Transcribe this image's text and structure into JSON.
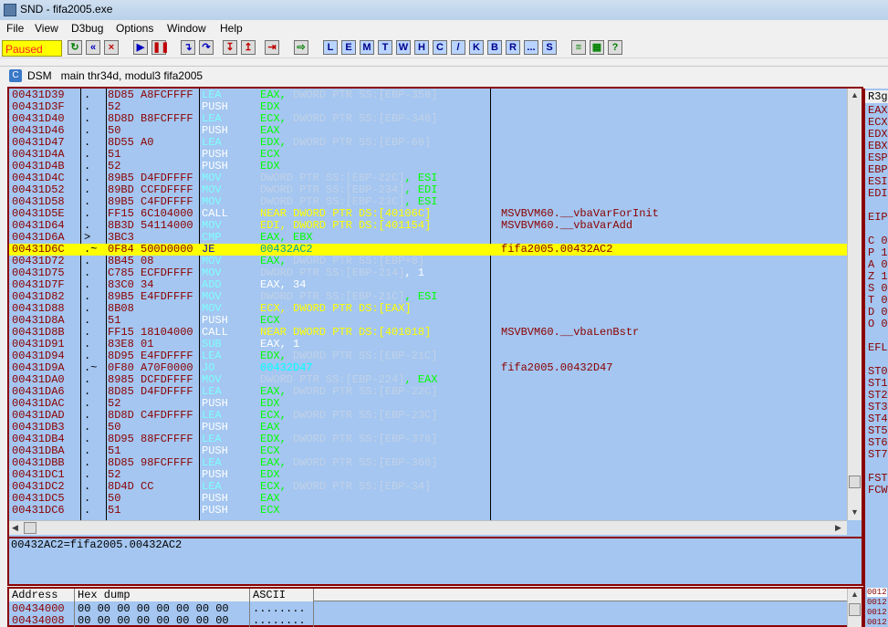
{
  "window": {
    "title": "SND - fifa2005.exe"
  },
  "menu": [
    "File",
    "View",
    "D3bug",
    "Options",
    "Window",
    "Help"
  ],
  "status": "Paused",
  "toolbar_letters": [
    "L",
    "E",
    "M",
    "T",
    "W",
    "H",
    "C",
    "/",
    "K",
    "B",
    "R",
    "...",
    "S"
  ],
  "dsm": {
    "title": "DSM   main thr34d, modul3 fifa2005"
  },
  "code": [
    {
      "addr": "00431D39",
      "mark": ".",
      "hex": "8D85 A8FCFFFF",
      "mn": "LEA",
      "op": "EAX,",
      "opc": "#00ff00",
      "blur": "DWORD PTR SS:[EBP-358]",
      "cm": ""
    },
    {
      "addr": "00431D3F",
      "mark": ".",
      "hex": "52",
      "mn": "PUSH",
      "op": "EDX",
      "opc": "#00ff00",
      "blur": "",
      "cm": ""
    },
    {
      "addr": "00431D40",
      "mark": ".",
      "hex": "8D8D B8FCFFFF",
      "mn": "LEA",
      "op": "ECX,",
      "opc": "#00ff00",
      "blur": "DWORD PTR SS:[EBP-348]",
      "cm": ""
    },
    {
      "addr": "00431D46",
      "mark": ".",
      "hex": "50",
      "mn": "PUSH",
      "op": "EAX",
      "opc": "#00ff00",
      "blur": "",
      "cm": ""
    },
    {
      "addr": "00431D47",
      "mark": ".",
      "hex": "8D55 A0",
      "mn": "LEA",
      "op": "EDX,",
      "opc": "#00ff00",
      "blur": "DWORD PTR SS:[EBP-60]",
      "cm": ""
    },
    {
      "addr": "00431D4A",
      "mark": ".",
      "hex": "51",
      "mn": "PUSH",
      "op": "ECX",
      "opc": "#00ff00",
      "blur": "",
      "cm": ""
    },
    {
      "addr": "00431D4B",
      "mark": ".",
      "hex": "52",
      "mn": "PUSH",
      "op": "EDX",
      "opc": "#00ff00",
      "blur": "",
      "cm": ""
    },
    {
      "addr": "00431D4C",
      "mark": ".",
      "hex": "89B5 D4FDFFFF",
      "mn": "MOV",
      "op": ", ESI",
      "opc": "#00ff00",
      "blur": "DWORD PTR SS:[EBP-22C]",
      "cm": ""
    },
    {
      "addr": "00431D52",
      "mark": ".",
      "hex": "89BD CCFDFFFF",
      "mn": "MOV",
      "op": ", EDI",
      "opc": "#00ff00",
      "blur": "DWORD PTR SS:[EBP-234]",
      "cm": ""
    },
    {
      "addr": "00431D58",
      "mark": ".",
      "hex": "89B5 C4FDFFFF",
      "mn": "MOV",
      "op": ", ESI",
      "opc": "#00ff00",
      "blur": "DWORD PTR SS:[EBP-23C]",
      "cm": ""
    },
    {
      "addr": "00431D5E",
      "mark": ".",
      "hex": "FF15 6C104000",
      "mn": "CALL",
      "op": "NEAR DWORD PTR DS:[40106C]",
      "opc": "#ffff00",
      "blur": "",
      "cm": "MSVBVM60.__vbaVarForInit"
    },
    {
      "addr": "00431D64",
      "mark": ".",
      "hex": "8B3D 54114000",
      "mn": "MOV",
      "op": "EDI, DWORD PTR DS:[401154]",
      "opc": "#ffff00",
      "blur": "",
      "cm": "MSVBVM60.__vbaVarAdd"
    },
    {
      "addr": "00431D6A",
      "mark": ">",
      "hex": "3BC3",
      "mn": "CMP",
      "op": "EAX, EBX",
      "opc": "#00ff00",
      "blur": "",
      "cm": ""
    },
    {
      "addr": "00431D6C",
      "mark": ".~",
      "hex": "0F84 500D0000",
      "mn": "JE",
      "op": "00432AC2",
      "opc": "#00a0a0",
      "blur": "",
      "cm": "fifa2005.00432AC2",
      "hl": true
    },
    {
      "addr": "00431D72",
      "mark": ".",
      "hex": "8B45 08",
      "mn": "MOV",
      "op": "EAX,",
      "opc": "#00ff00",
      "blur": "DWORD PTR SS:[EBP+8]",
      "cm": ""
    },
    {
      "addr": "00431D75",
      "mark": ".",
      "hex": "C785 ECFDFFFF",
      "mn": "MOV",
      "op": ", 1",
      "opc": "#ffffff",
      "blur": "DWORD PTR SS:[EBP-214]",
      "cm": ""
    },
    {
      "addr": "00431D7F",
      "mark": ".",
      "hex": "83C0 34",
      "mn": "ADD",
      "op": "EAX, 34",
      "opc": "#ffffff",
      "blur": "",
      "cm": ""
    },
    {
      "addr": "00431D82",
      "mark": ".",
      "hex": "89B5 E4FDFFFF",
      "mn": "MOV",
      "op": ", ESI",
      "opc": "#00ff00",
      "blur": "DWORD PTR SS:[EBP-21C]",
      "cm": ""
    },
    {
      "addr": "00431D88",
      "mark": ".",
      "hex": "8B08",
      "mn": "MOV",
      "op": "ECX, DWORD PTR DS:[EAX]",
      "opc": "#ffff00",
      "blur": "",
      "cm": ""
    },
    {
      "addr": "00431D8A",
      "mark": ".",
      "hex": "51",
      "mn": "PUSH",
      "op": "ECX",
      "opc": "#00ff00",
      "blur": "",
      "cm": ""
    },
    {
      "addr": "00431D8B",
      "mark": ".",
      "hex": "FF15 18104000",
      "mn": "CALL",
      "op": "NEAR DWORD PTR DS:[401018]",
      "opc": "#ffff00",
      "blur": "",
      "cm": "MSVBVM60.__vbaLenBstr"
    },
    {
      "addr": "00431D91",
      "mark": ".",
      "hex": "83E8 01",
      "mn": "SUB",
      "op": "EAX, 1",
      "opc": "#ffffff",
      "blur": "",
      "cm": ""
    },
    {
      "addr": "00431D94",
      "mark": ".",
      "hex": "8D95 E4FDFFFF",
      "mn": "LEA",
      "op": "EDX,",
      "opc": "#00ff00",
      "blur": "DWORD PTR SS:[EBP-21C]",
      "cm": ""
    },
    {
      "addr": "00431D9A",
      "mark": ".~",
      "hex": "0F80 A70F0000",
      "mn": "JO",
      "op": "00432D47",
      "opc": "#00ffff",
      "blur": "",
      "cm": "fifa2005.00432D47"
    },
    {
      "addr": "00431DA0",
      "mark": ".",
      "hex": "8985 DCFDFFFF",
      "mn": "MOV",
      "op": ", EAX",
      "opc": "#00ff00",
      "blur": "DWORD PTR SS:[EBP-224]",
      "cm": ""
    },
    {
      "addr": "00431DA6",
      "mark": ".",
      "hex": "8D85 D4FDFFFF",
      "mn": "LEA",
      "op": "EAX,",
      "opc": "#00ff00",
      "blur": "DWORD PTR SS:[EBP-22C]",
      "cm": ""
    },
    {
      "addr": "00431DAC",
      "mark": ".",
      "hex": "52",
      "mn": "PUSH",
      "op": "EDX",
      "opc": "#00ff00",
      "blur": "",
      "cm": ""
    },
    {
      "addr": "00431DAD",
      "mark": ".",
      "hex": "8D8D C4FDFFFF",
      "mn": "LEA",
      "op": "ECX,",
      "opc": "#00ff00",
      "blur": "DWORD PTR SS:[EBP-23C]",
      "cm": ""
    },
    {
      "addr": "00431DB3",
      "mark": ".",
      "hex": "50",
      "mn": "PUSH",
      "op": "EAX",
      "opc": "#00ff00",
      "blur": "",
      "cm": ""
    },
    {
      "addr": "00431DB4",
      "mark": ".",
      "hex": "8D95 88FCFFFF",
      "mn": "LEA",
      "op": "EDX,",
      "opc": "#00ff00",
      "blur": "DWORD PTR SS:[EBP-378]",
      "cm": ""
    },
    {
      "addr": "00431DBA",
      "mark": ".",
      "hex": "51",
      "mn": "PUSH",
      "op": "ECX",
      "opc": "#00ff00",
      "blur": "",
      "cm": ""
    },
    {
      "addr": "00431DBB",
      "mark": ".",
      "hex": "8D85 98FCFFFF",
      "mn": "LEA",
      "op": "EAX,",
      "opc": "#00ff00",
      "blur": "DWORD PTR SS:[EBP-368]",
      "cm": ""
    },
    {
      "addr": "00431DC1",
      "mark": ".",
      "hex": "52",
      "mn": "PUSH",
      "op": "EDX",
      "opc": "#00ff00",
      "blur": "",
      "cm": ""
    },
    {
      "addr": "00431DC2",
      "mark": ".",
      "hex": "8D4D CC",
      "mn": "LEA",
      "op": "ECX,",
      "opc": "#00ff00",
      "blur": "DWORD PTR SS:[EBP-34]",
      "cm": ""
    },
    {
      "addr": "00431DC5",
      "mark": ".",
      "hex": "50",
      "mn": "PUSH",
      "op": "EAX",
      "opc": "#00ff00",
      "blur": "",
      "cm": ""
    },
    {
      "addr": "00431DC6",
      "mark": ".",
      "hex": "51",
      "mn": "PUSH",
      "op": "ECX",
      "opc": "#00ff00",
      "blur": "",
      "cm": ""
    }
  ],
  "info": "00432AC2=fifa2005.00432AC2",
  "dump": {
    "headers": [
      "Address",
      "Hex dump",
      "ASCII"
    ],
    "rows": [
      {
        "addr": "00434000",
        "hex": "00 00 00 00 00 00 00 00",
        "ascii": "........"
      },
      {
        "addr": "00434008",
        "hex": "00 00 00 00 00 00 00 00",
        "ascii": "........"
      }
    ]
  },
  "registers": {
    "header": "R3g",
    "items": [
      "EAX",
      "ECX",
      "EDX",
      "EBX",
      "ESP",
      "EBP",
      "ESI",
      "EDI",
      "",
      "EIP",
      "",
      "C 0",
      "P 1",
      "A 0",
      "Z 1",
      "S 0",
      "T 0",
      "D 0",
      "O 0",
      "",
      "EFL",
      "",
      "ST0",
      "ST1",
      "ST2",
      "ST3",
      "ST4",
      "ST5",
      "ST6",
      "ST7",
      "",
      "FST",
      "FCW"
    ]
  },
  "stack": [
    "0012",
    "0012",
    "0012",
    "0012"
  ]
}
